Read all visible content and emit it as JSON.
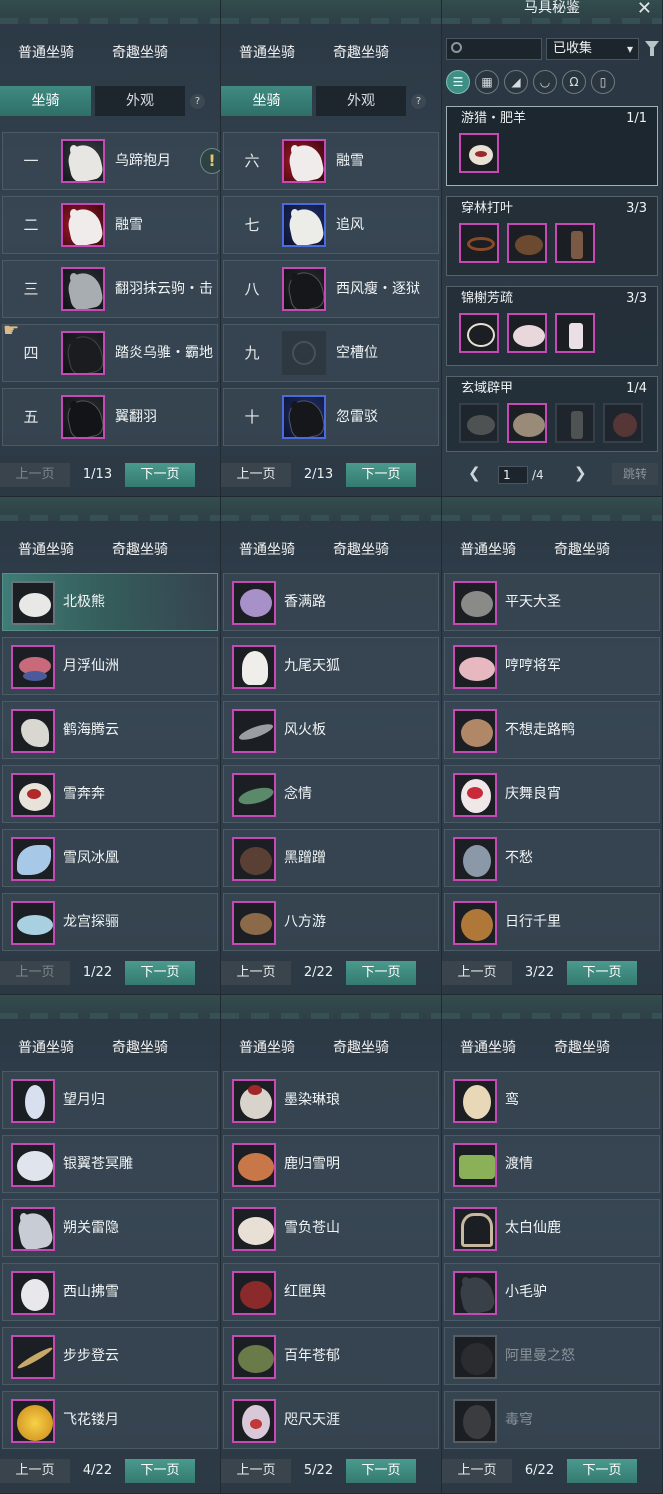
{
  "tabs": {
    "normal": "普通坐骑",
    "fun": "奇趣坐骑"
  },
  "subtabs": {
    "mount": "坐骑",
    "appearance": "外观",
    "help": "?"
  },
  "pager": {
    "prev": "上一页",
    "next": "下一页"
  },
  "slot_panels": [
    {
      "page": "1/13",
      "rows": [
        {
          "num": "一",
          "name": "乌蹄抱月"
        },
        {
          "num": "二",
          "name": "融雪"
        },
        {
          "num": "三",
          "name": "翻羽抹云驹・击"
        },
        {
          "num": "四",
          "name": "踏炎乌骓・霸地"
        },
        {
          "num": "五",
          "name": "翼翻羽"
        }
      ]
    },
    {
      "page": "2/13",
      "rows": [
        {
          "num": "六",
          "name": "融雪"
        },
        {
          "num": "七",
          "name": "追风"
        },
        {
          "num": "八",
          "name": "西风瘦・逐狱"
        },
        {
          "num": "九",
          "name": "空槽位"
        },
        {
          "num": "十",
          "name": "忽雷驳"
        }
      ]
    }
  ],
  "encyclopedia": {
    "title": "马具秘鉴",
    "close": "✕",
    "filter_value": "已收集",
    "filter_caret": "▾",
    "categories": [
      "☰",
      "▦",
      "◢",
      "◡",
      "Ω",
      "▯"
    ],
    "sets": [
      {
        "name": "游猎・肥羊",
        "count": "1/1"
      },
      {
        "name": "穿林打叶",
        "count": "3/3"
      },
      {
        "name": "锦榭芳疏",
        "count": "3/3"
      },
      {
        "name": "玄域辟甲",
        "count": "1/4"
      }
    ],
    "prev_arrow": "❮",
    "next_arrow": "❯",
    "page_input": "1",
    "page_total": "/4",
    "jump": "跳转"
  },
  "list_panels": [
    {
      "page": "1/22",
      "rows": [
        "北极熊",
        "月浮仙洲",
        "鹤海腾云",
        "雪奔奔",
        "雪凤冰凰",
        "龙宫探骊"
      ]
    },
    {
      "page": "2/22",
      "rows": [
        "香满路",
        "九尾天狐",
        "风火板",
        "念情",
        "黑蹭蹭",
        "八方游"
      ]
    },
    {
      "page": "3/22",
      "rows": [
        "平天大圣",
        "哼哼将军",
        "不想走路鸭",
        "庆舞良宵",
        "不愁",
        "日行千里"
      ]
    },
    {
      "page": "4/22",
      "rows": [
        "望月归",
        "银翼苍冥雕",
        "朔关雷隐",
        "西山拂雪",
        "步步登云",
        "飞花镂月"
      ]
    },
    {
      "page": "5/22",
      "rows": [
        "墨染琳琅",
        "鹿归雪明",
        "雪负苍山",
        "红匣舆",
        "百年苍郁",
        "咫尺天涯"
      ]
    },
    {
      "page": "6/22",
      "rows": [
        "鸾",
        "渡情",
        "太白仙鹿",
        "小毛驴",
        "阿里曼之怒",
        "毒穹"
      ]
    }
  ],
  "alert_glyph": "!",
  "hand_glyph": "☛"
}
